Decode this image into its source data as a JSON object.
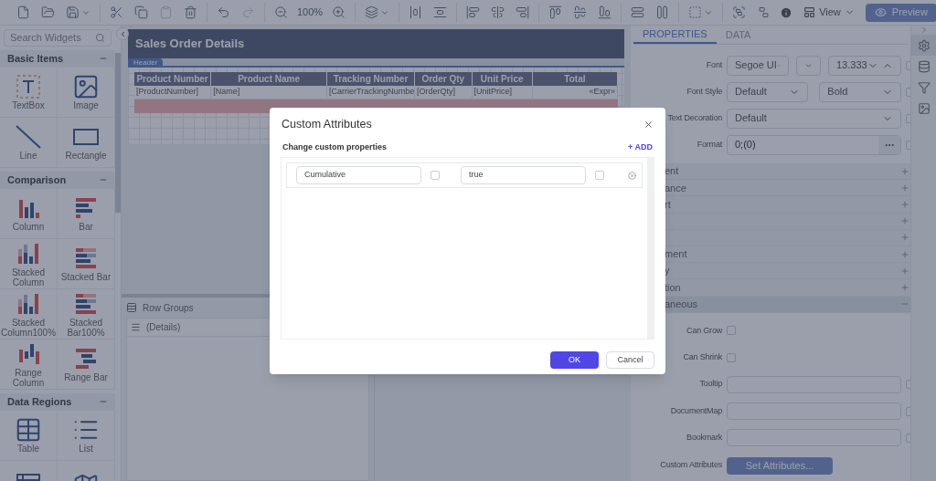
{
  "toolbar": {
    "groups": [
      [
        {
          "kind": "new",
          "disabled": false
        },
        {
          "kind": "open",
          "disabled": false
        },
        {
          "kind": "save",
          "disabled": false,
          "caret": true
        }
      ],
      [
        {
          "kind": "cut",
          "disabled": false
        },
        {
          "kind": "copy",
          "disabled": false
        },
        {
          "kind": "paste",
          "disabled": true
        },
        {
          "kind": "delete",
          "disabled": false
        }
      ],
      [
        {
          "kind": "undo",
          "disabled": false
        },
        {
          "kind": "redo",
          "disabled": true
        }
      ],
      [
        {
          "kind": "zoom-out",
          "disabled": false
        },
        {
          "kind": "zoom-level",
          "label": "100%",
          "disabled": false
        },
        {
          "kind": "zoom-in",
          "disabled": false
        }
      ],
      [
        {
          "kind": "arrange",
          "disabled": false,
          "caret": true
        }
      ],
      [
        {
          "kind": "space-horizontal",
          "disabled": false
        },
        {
          "kind": "space-vertical",
          "disabled": false
        }
      ],
      [
        {
          "kind": "align-left",
          "disabled": false
        },
        {
          "kind": "align-center",
          "disabled": false
        },
        {
          "kind": "align-right",
          "disabled": false
        }
      ],
      [
        {
          "kind": "align-top",
          "disabled": false
        },
        {
          "kind": "align-middle",
          "disabled": false
        },
        {
          "kind": "align-bottom",
          "disabled": false
        }
      ],
      [
        {
          "kind": "same-width",
          "disabled": false
        },
        {
          "kind": "same-height",
          "disabled": false
        }
      ],
      [
        {
          "kind": "select",
          "disabled": false,
          "caret": true
        }
      ],
      [
        {
          "kind": "group",
          "disabled": false
        },
        {
          "kind": "ungroup",
          "disabled": false
        }
      ]
    ],
    "view": "View",
    "preview": "Preview"
  },
  "sidebar": {
    "search_placeholder": "Search Widgets",
    "sections": [
      {
        "title": "Basic Items",
        "expanded": true,
        "items": [
          {
            "label": "TextBox",
            "kind": "textbox"
          },
          {
            "label": "Image",
            "kind": "image"
          },
          {
            "label": "Line",
            "kind": "line"
          },
          {
            "label": "Rectangle",
            "kind": "rectangle"
          }
        ]
      },
      {
        "title": "Comparison",
        "expanded": true,
        "items": [
          {
            "label": "Column",
            "kind": "column"
          },
          {
            "label": "Bar",
            "kind": "bar"
          },
          {
            "label": "Stacked Column",
            "kind": "stacked-column"
          },
          {
            "label": "Stacked Bar",
            "kind": "stacked-bar"
          },
          {
            "label": "Stacked Column100%",
            "kind": "stacked-column"
          },
          {
            "label": "Stacked Bar100%",
            "kind": "stacked-bar"
          },
          {
            "label": "Range Column",
            "kind": "range-column"
          },
          {
            "label": "Range Bar",
            "kind": "range-bar"
          }
        ]
      },
      {
        "title": "Data Regions",
        "expanded": true,
        "items": [
          {
            "label": "Table",
            "kind": "table"
          },
          {
            "label": "List",
            "kind": "list"
          },
          {
            "kind": "matrix"
          },
          {
            "kind": "map"
          }
        ]
      }
    ]
  },
  "designer": {
    "report_title": "Sales Order Details",
    "band": "Header",
    "table": {
      "columns": [
        "Product Number",
        "Product Name",
        "Tracking Number",
        "Order Qty",
        "Unit Price",
        "Total"
      ],
      "row": [
        "[ProductNumber]",
        "[Name]",
        "[CarrierTrackingNumbe",
        "[OrderQty]",
        "[UnitPrice]",
        "«Expr»"
      ]
    },
    "row_groups": {
      "title": "Row Groups",
      "items": [
        "(Details)"
      ]
    }
  },
  "properties": {
    "tabs": [
      {
        "label": "PROPERTIES",
        "selected": true
      },
      {
        "label": "DATA",
        "selected": false
      }
    ],
    "rows": [
      {
        "kind": "font",
        "label": "Font",
        "family": "Segoe UI",
        "size": "13.333",
        "checked": false
      },
      {
        "kind": "two-select",
        "label": "Font Style",
        "values": [
          "Default",
          "Bold"
        ],
        "checked": false
      },
      {
        "kind": "select",
        "label": "Text Decoration",
        "value": "Default",
        "checked": false
      },
      {
        "kind": "format",
        "label": "Format",
        "value": "0;(0)",
        "checked": false
      }
    ],
    "groups": [
      {
        "label": "ent",
        "expanded": false
      },
      {
        "label": "ance",
        "expanded": false
      },
      {
        "label": "rt",
        "expanded": false
      },
      {
        "expanded": false
      },
      {
        "expanded": false
      },
      {
        "label": "ment",
        "expanded": false
      },
      {
        "label": "y",
        "expanded": false
      },
      {
        "label": "tion",
        "expanded": false
      },
      {
        "label": "aneous",
        "expanded": true
      }
    ],
    "misc_rows": [
      {
        "kind": "checkbox",
        "label": "Can Grow",
        "checked": false
      },
      {
        "kind": "checkbox",
        "label": "Can Shrink",
        "checked": false
      },
      {
        "kind": "text",
        "label": "Tooltip",
        "checked": false
      },
      {
        "kind": "text",
        "label": "DocumentMap",
        "checked": false
      },
      {
        "kind": "text",
        "label": "Bookmark",
        "checked": false
      },
      {
        "kind": "button",
        "label": "Custom Attributes",
        "button": "Set Attributes..."
      }
    ]
  },
  "side_icons": [
    {
      "kind": "settings",
      "selected": true
    },
    {
      "kind": "database",
      "selected": false
    },
    {
      "kind": "filter",
      "selected": false
    },
    {
      "kind": "image",
      "selected": false
    }
  ],
  "dialog": {
    "title": "Custom Attributes",
    "subtitle": "Change custom properties",
    "add": "+ ADD",
    "attributes": [
      {
        "name": "Cumulative",
        "name_checked": false,
        "value": "true",
        "value_checked": false
      }
    ],
    "buttons": [
      {
        "label": "OK",
        "kind": "primary"
      },
      {
        "label": "Cancel",
        "kind": "secondary"
      }
    ]
  }
}
